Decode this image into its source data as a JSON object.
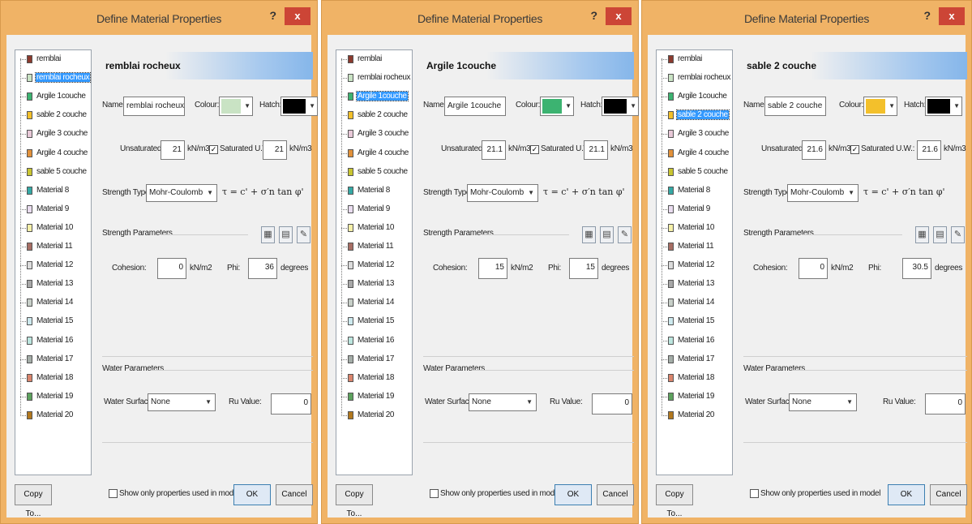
{
  "dialog_title": "Define Material Properties",
  "help_label": "?",
  "close_label": "x",
  "labels": {
    "name": "Name:",
    "colour": "Colour:",
    "hatch": "Hatch:",
    "unsaturated": "Unsaturated",
    "saturated": "Saturated U.W.:",
    "unit_kn_m3": "kN/m3",
    "strength_type": "Strength Type:",
    "strength_params": "Strength Parameters",
    "cohesion": "Cohesion:",
    "kn_m2": "kN/m2",
    "phi": "Phi:",
    "degrees": "degrees",
    "water_params": "Water Parameters",
    "water_surface": "Water Surface:",
    "ru_value": "Ru Value:",
    "copy_to": "Copy To...",
    "show_only": "Show only properties used in model",
    "ok": "OK",
    "cancel": "Cancel",
    "formula": "τ = c' + σ′n tan φ'"
  },
  "materials": [
    {
      "label": "remblai",
      "color": "#8b3a2e"
    },
    {
      "label": "remblai rocheux",
      "color": "#c9e3c4"
    },
    {
      "label": "Argile 1couche",
      "color": "#3cb371"
    },
    {
      "label": "sable 2 couche",
      "color": "#f3c02b"
    },
    {
      "label": "Argile 3 couche",
      "color": "#e8c9d8"
    },
    {
      "label": "Argile 4 couche",
      "color": "#e2913a"
    },
    {
      "label": "sable 5 couche",
      "color": "#c9c531"
    },
    {
      "label": "Material 8",
      "color": "#35a9a5"
    },
    {
      "label": "Material 9",
      "color": "#e9dcef"
    },
    {
      "label": "Material 10",
      "color": "#f5f0a8"
    },
    {
      "label": "Material 11",
      "color": "#a76e64"
    },
    {
      "label": "Material 12",
      "color": "#dcdcdc"
    },
    {
      "label": "Material 13",
      "color": "#a8a8a8"
    },
    {
      "label": "Material 14",
      "color": "#c7cfc8"
    },
    {
      "label": "Material 15",
      "color": "#cde9ee"
    },
    {
      "label": "Material 16",
      "color": "#bce6df"
    },
    {
      "label": "Material 17",
      "color": "#a4ada8"
    },
    {
      "label": "Material 18",
      "color": "#d9846c"
    },
    {
      "label": "Material 19",
      "color": "#5da25e"
    },
    {
      "label": "Material 20",
      "color": "#b2781e"
    }
  ],
  "dialogs": [
    {
      "selected_index": 1,
      "header": "remblai rocheux",
      "name": "remblai rocheux",
      "colour": "#c9e3c4",
      "hatch": "#000000",
      "unsaturated": "21",
      "saturated_checked": true,
      "saturated": "21",
      "strength_type": "Mohr-Coulomb",
      "cohesion": "0",
      "phi": "36",
      "water_surface": "None",
      "ru_value": "0",
      "show_only_checked": false
    },
    {
      "selected_index": 2,
      "header": "Argile 1couche",
      "name": "Argile 1couche",
      "colour": "#3cb371",
      "hatch": "#000000",
      "unsaturated": "21.1",
      "saturated_checked": true,
      "saturated": "21.1",
      "strength_type": "Mohr-Coulomb",
      "cohesion": "15",
      "phi": "15",
      "water_surface": "None",
      "ru_value": "0",
      "show_only_checked": false
    },
    {
      "selected_index": 3,
      "header": "sable 2 couche",
      "name": "sable 2 couche",
      "colour": "#f3c02b",
      "hatch": "#000000",
      "unsaturated": "21.6",
      "saturated_checked": true,
      "saturated": "21.6",
      "strength_type": "Mohr-Coulomb",
      "cohesion": "0",
      "phi": "30.5",
      "water_surface": "None",
      "ru_value": "0",
      "show_only_checked": false
    }
  ]
}
